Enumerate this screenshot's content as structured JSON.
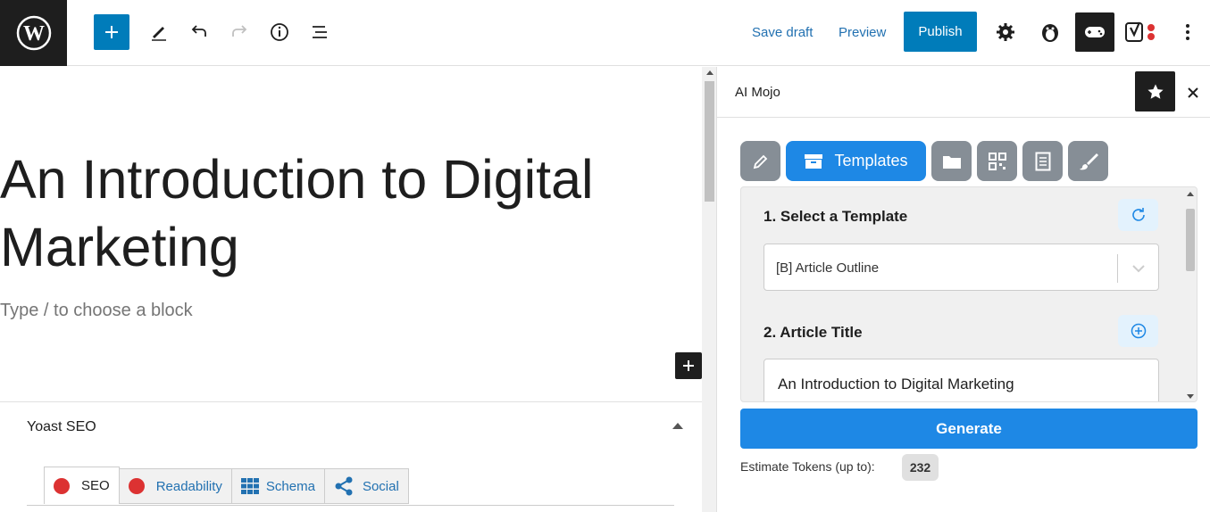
{
  "topbar": {
    "logo_icon": "wordpress-logo-icon",
    "add_icon": "plus-icon",
    "tools_icon": "pencil-icon",
    "undo_icon": "undo-icon",
    "redo_icon": "redo-icon",
    "details_icon": "info-icon",
    "outline_icon": "list-view-icon",
    "save_draft": "Save draft",
    "preview": "Preview",
    "publish": "Publish",
    "settings_icon": "gear-icon",
    "plugin_icons": [
      "penguin-icon",
      "gamepad-icon",
      "yoast-icon"
    ],
    "options_icon": "more-vertical-icon",
    "accent_color": "#007cba"
  },
  "editor": {
    "post_title": "An Introduction to Digital Marketing",
    "block_placeholder": "Type / to choose a block"
  },
  "yoast": {
    "title": "Yoast SEO",
    "tabs": [
      {
        "label": "SEO",
        "icon": "red-dot-icon"
      },
      {
        "label": "Readability",
        "icon": "red-dot-icon"
      },
      {
        "label": "Schema",
        "icon": "grid-icon"
      },
      {
        "label": "Social",
        "icon": "share-icon"
      }
    ]
  },
  "sidebar": {
    "title": "AI Mojo",
    "tools": [
      {
        "icon": "pencil-icon",
        "label": ""
      },
      {
        "icon": "archive-box-icon",
        "label": "Templates",
        "active": true
      },
      {
        "icon": "folder-icon",
        "label": ""
      },
      {
        "icon": "qr-code-icon",
        "label": ""
      },
      {
        "icon": "document-icon",
        "label": ""
      },
      {
        "icon": "brush-icon",
        "label": ""
      }
    ],
    "section1_label": "1. Select a Template",
    "template_value": "[B] Article Outline",
    "section2_label": "2. Article Title",
    "article_title_value": "An Introduction to Digital Marketing",
    "generate": "Generate",
    "tokens_label": "Estimate Tokens (up to):",
    "tokens_value": "232",
    "accent_color": "#1e88e5"
  }
}
